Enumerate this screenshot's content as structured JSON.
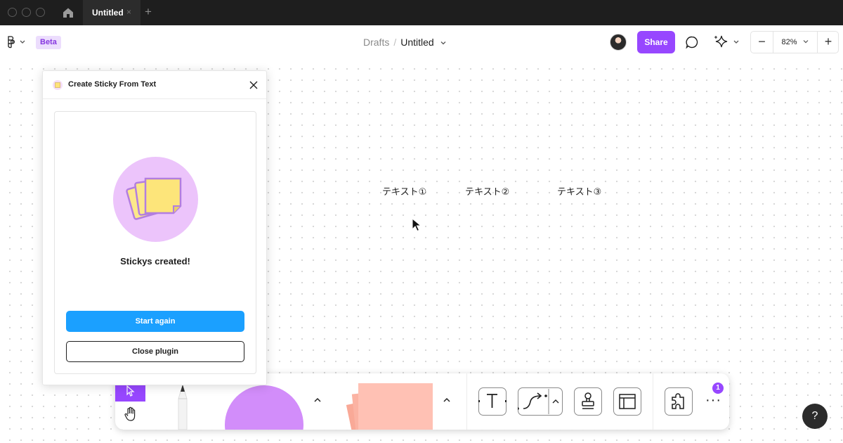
{
  "titlebar": {
    "tab_title": "Untitled",
    "tab_close_glyph": "×",
    "new_tab_glyph": "+",
    "icons": [
      "home-icon"
    ]
  },
  "header": {
    "beta_label": "Beta",
    "breadcrumb_parent": "Drafts",
    "breadcrumb_separator": "/",
    "file_name": "Untitled",
    "share_label": "Share",
    "zoom_level": "82%",
    "zoom_out_glyph": "−",
    "zoom_in_glyph": "+",
    "accent_color": "#9747ff"
  },
  "canvas": {
    "texts": [
      "テキスト①",
      "テキスト②",
      "テキスト③"
    ]
  },
  "plugin": {
    "title": "Create Sticky From Text",
    "message": "Stickys created!",
    "primary_button": "Start again",
    "secondary_button": "Close plugin",
    "primary_color": "#1ba0ff",
    "illustration_bg": "#ecc4fb"
  },
  "dock": {
    "notification_count": "1",
    "more_glyph": "···",
    "tools": [
      "select-tool",
      "hand-tool",
      "pencil-tool",
      "shape-tool",
      "sticky-tool",
      "text-tool",
      "connector-tool",
      "stamp-tool",
      "section-tool",
      "plugins-tool"
    ],
    "shape_color": "#d28dfa",
    "sticky_color": "#ffc1b4"
  },
  "help_glyph": "?"
}
